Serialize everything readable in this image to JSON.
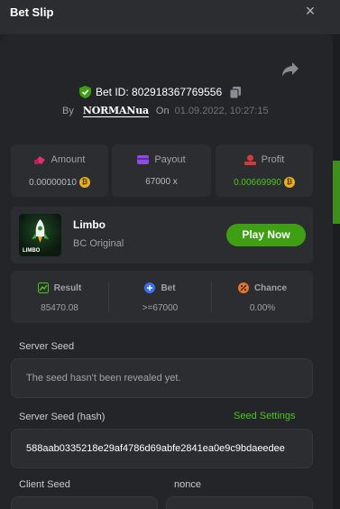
{
  "header": {
    "title": "Bet Slip",
    "close_glyph": "×"
  },
  "bet": {
    "id_label": "Bet ID: 802918367769556",
    "by_label": "By",
    "user": "NORMANua",
    "on_label": "On",
    "date": "01.09.2022, 10:27:15"
  },
  "stats": [
    {
      "label": "Amount",
      "value": "0.00000010",
      "icon": "money-icon"
    },
    {
      "label": "Payout",
      "value": "67000 x",
      "icon": "wallet-icon"
    },
    {
      "label": "Profit",
      "value": "0.00669990",
      "icon": "profit-icon"
    }
  ],
  "game": {
    "name": "Limbo",
    "provider": "BC Original",
    "thumb_label": "LIMBO",
    "play_label": "Play Now"
  },
  "results": [
    {
      "label": "Result",
      "value": "85470.08",
      "icon": "result-icon"
    },
    {
      "label": "Bet",
      "value": ">=67000",
      "icon": "bet-icon"
    },
    {
      "label": "Chance",
      "value": "0.00%",
      "icon": "chance-icon"
    }
  ],
  "server_seed": {
    "label": "Server Seed",
    "value": "The seed hasn't been revealed yet."
  },
  "server_seed_hash": {
    "label": "Server Seed (hash)",
    "settings_label": "Seed Settings",
    "value": "588aab0335218e29af4786d69abfe2841ea0e9c9bdaeedee"
  },
  "client_seed": {
    "label": "Client Seed"
  },
  "nonce": {
    "label": "nonce"
  },
  "colors": {
    "accent": "#3f9f14",
    "green_text": "#4ec51f",
    "panel": "#232528",
    "card": "#2b2d31"
  }
}
